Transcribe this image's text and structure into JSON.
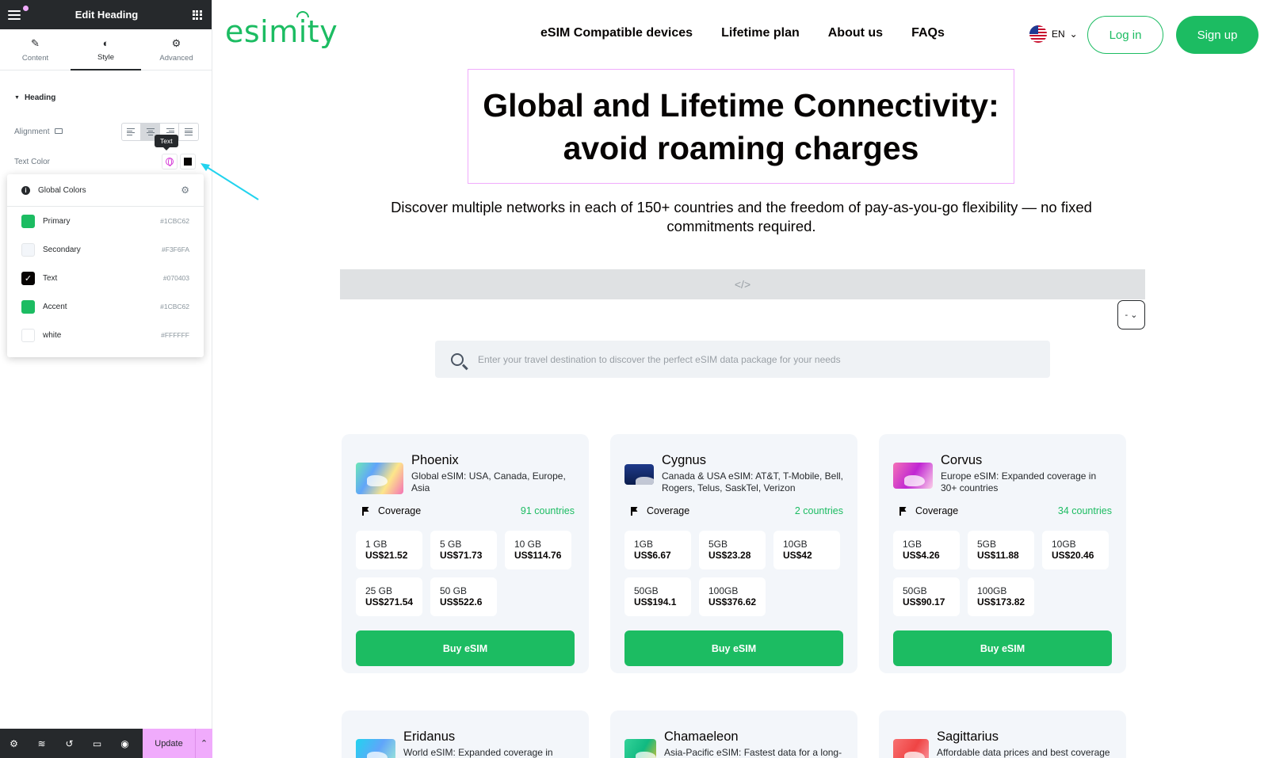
{
  "colors": {
    "brand": "#1CBC62",
    "text": "#070403",
    "editor_dark": "#26292C",
    "editor_accent": "#F0ABFC",
    "arrow": "#22D3EE"
  },
  "editor": {
    "title": "Edit Heading",
    "tabs": [
      {
        "label": "Content",
        "icon": "pencil-icon"
      },
      {
        "label": "Style",
        "icon": "half-circle-icon"
      },
      {
        "label": "Advanced",
        "icon": "gear-icon"
      }
    ],
    "section": "Heading",
    "alignment_label": "Alignment",
    "text_color_label": "Text Color",
    "tooltip": "Text",
    "global_colors": {
      "title": "Global Colors",
      "items": [
        {
          "name": "Primary",
          "hex": "#1CBC62",
          "selected": false
        },
        {
          "name": "Secondary",
          "hex": "#F3F6FA",
          "selected": false
        },
        {
          "name": "Text",
          "hex": "#070403",
          "selected": true
        },
        {
          "name": "Accent",
          "hex": "#1CBC62",
          "selected": false
        },
        {
          "name": "white",
          "hex": "#FFFFFF",
          "selected": false
        }
      ]
    },
    "footer": {
      "update_label": "Update"
    }
  },
  "site": {
    "logo": "esimity",
    "nav": [
      "eSIM Compatible devices",
      "Lifetime plan",
      "About us",
      "FAQs"
    ],
    "lang": "EN",
    "login": "Log in",
    "signup": "Sign up",
    "hero_title": "Global and Lifetime Connectivity: avoid roaming charges",
    "hero_subtitle": "Discover multiple networks in each of 150+ countries and the freedom of pay-as-you-go flexibility — no fixed commitments required.",
    "code_placeholder": "</>",
    "mini_dropdown": "-",
    "search_placeholder": "Enter your travel destination to discover the perfect eSIM data package for your needs",
    "coverage_label": "Coverage",
    "buy_label": "Buy eSIM",
    "cards": [
      {
        "name": "Phoenix",
        "desc": "Global eSIM: USA, Canada, Europe, Asia",
        "coverage": "91 countries",
        "plans": [
          {
            "gb": "1 GB",
            "price": "US$21.52"
          },
          {
            "gb": "5 GB",
            "price": "US$71.73"
          },
          {
            "gb": "10 GB",
            "price": "US$114.76"
          },
          {
            "gb": "25 GB",
            "price": "US$271.54"
          },
          {
            "gb": "50 GB",
            "price": "US$522.6"
          }
        ]
      },
      {
        "name": "Cygnus",
        "desc": "Canada & USA eSIM: AT&T, T-Mobile, Bell, Rogers, Telus, SaskTel, Verizon",
        "coverage": "2 countries",
        "plans": [
          {
            "gb": "1GB",
            "price": "US$6.67"
          },
          {
            "gb": "5GB",
            "price": "US$23.28"
          },
          {
            "gb": "10GB",
            "price": "US$42"
          },
          {
            "gb": "50GB",
            "price": "US$194.1"
          },
          {
            "gb": "100GB",
            "price": "US$376.62"
          }
        ]
      },
      {
        "name": "Corvus",
        "desc": "Europe eSIM: Expanded coverage in 30+ countries",
        "coverage": "34 countries",
        "plans": [
          {
            "gb": "1GB",
            "price": "US$4.26"
          },
          {
            "gb": "5GB",
            "price": "US$11.88"
          },
          {
            "gb": "10GB",
            "price": "US$20.46"
          },
          {
            "gb": "50GB",
            "price": "US$90.17"
          },
          {
            "gb": "100GB",
            "price": "US$173.82"
          }
        ]
      }
    ],
    "partial_cards": [
      {
        "name": "Eridanus",
        "desc": "World eSIM: Expanded coverage in"
      },
      {
        "name": "Chamaeleon",
        "desc": "Asia-Pacific eSIM: Fastest data for a long-"
      },
      {
        "name": "Sagittarius",
        "desc": "Affordable data prices and best coverage"
      }
    ]
  }
}
